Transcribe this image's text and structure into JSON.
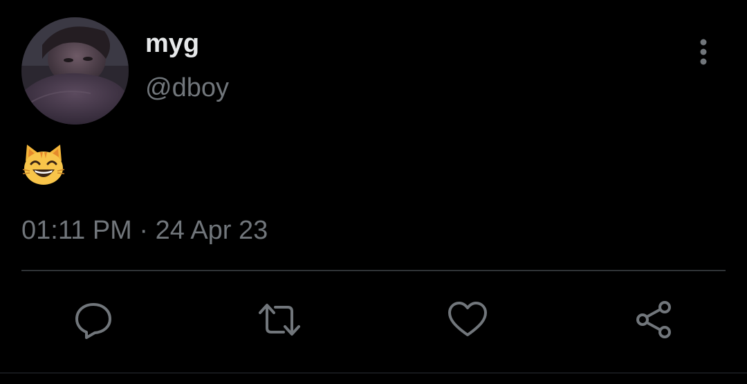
{
  "tweet": {
    "display_name": "myg",
    "handle": "@dboy",
    "body_emoji": "grinning-cat-with-smiling-eyes",
    "timestamp": "01:11 PM · 24 Apr 23"
  },
  "actions": [
    {
      "name": "reply",
      "icon": "reply-icon"
    },
    {
      "name": "retweet",
      "icon": "retweet-icon"
    },
    {
      "name": "like",
      "icon": "heart-icon"
    },
    {
      "name": "share",
      "icon": "share-icon"
    }
  ],
  "colors": {
    "background": "#000000",
    "primary_text": "#e7e9ea",
    "secondary_text": "#71767b",
    "divider": "#2f3336",
    "icon": "#71767b"
  }
}
